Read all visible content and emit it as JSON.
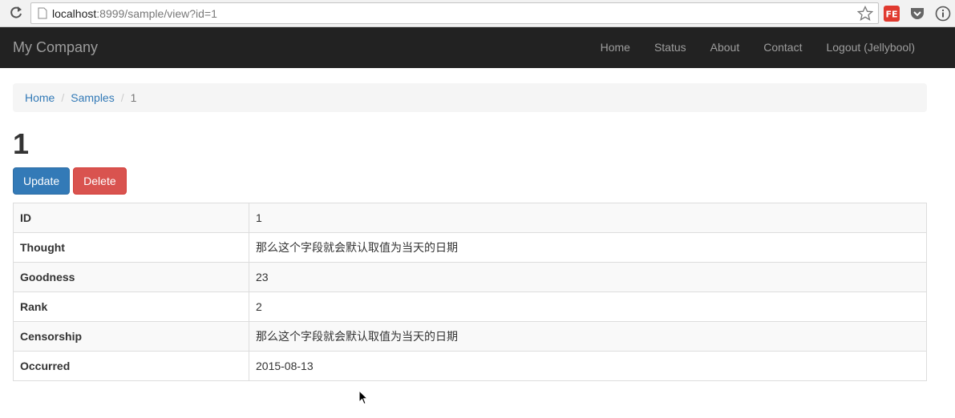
{
  "browser": {
    "url_host": "localhost",
    "url_rest": ":8999/sample/view?id=1",
    "ext_fe_label": "FE"
  },
  "navbar": {
    "brand": "My Company",
    "links": [
      "Home",
      "Status",
      "About",
      "Contact",
      "Logout (Jellybool)"
    ]
  },
  "breadcrumb": {
    "items": [
      "Home",
      "Samples"
    ],
    "active": "1",
    "separator": "/"
  },
  "page": {
    "title": "1",
    "update_label": "Update",
    "delete_label": "Delete"
  },
  "detail": {
    "rows": [
      {
        "label": "ID",
        "value": "1"
      },
      {
        "label": "Thought",
        "value": "那么这个字段就会默认取值为当天的日期"
      },
      {
        "label": "Goodness",
        "value": "23"
      },
      {
        "label": "Rank",
        "value": "2"
      },
      {
        "label": "Censorship",
        "value": "那么这个字段就会默认取值为当天的日期"
      },
      {
        "label": "Occurred",
        "value": "2015-08-13"
      }
    ]
  },
  "colors": {
    "navbar_bg": "#222222",
    "link": "#337ab7",
    "primary": "#337ab7",
    "danger": "#d9534f"
  }
}
